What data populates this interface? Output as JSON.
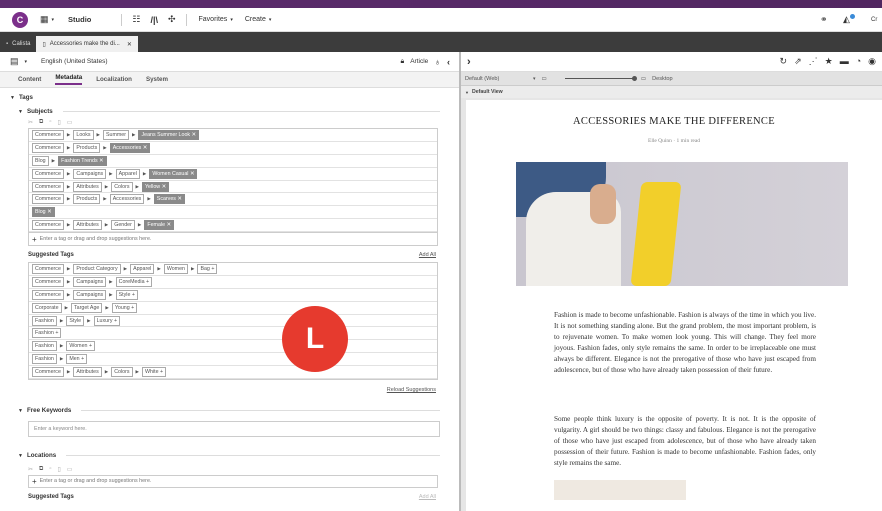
{
  "topbar": {
    "studio": "Studio",
    "favorites": "Favorites",
    "create": "Create",
    "user_initials": "Cr"
  },
  "tabs": [
    {
      "label": "Calista"
    },
    {
      "label": "Accessories make the di..."
    }
  ],
  "left_toolbar": {
    "locale": "English (United States)",
    "doc_type": "Article"
  },
  "subtabs": [
    "Content",
    "Metadata",
    "Localization",
    "System"
  ],
  "tags": {
    "title": "Tags",
    "subjects_title": "Subjects",
    "subject_rows": [
      [
        {
          "t": "Commerce"
        },
        {
          "t": "Looks"
        },
        {
          "t": "Summer"
        },
        {
          "t": "Jeans Summer Look ✕",
          "s": true
        }
      ],
      [
        {
          "t": "Commerce"
        },
        {
          "t": "Products"
        },
        {
          "t": "Accessories ✕",
          "s": true
        }
      ],
      [
        {
          "t": "Blog"
        },
        {
          "t": "Fashion Trends ✕",
          "s": true
        }
      ],
      [
        {
          "t": "Commerce"
        },
        {
          "t": "Campaigns"
        },
        {
          "t": "Apparel"
        },
        {
          "t": "Women Casual ✕",
          "s": true
        }
      ],
      [
        {
          "t": "Commerce"
        },
        {
          "t": "Attributes"
        },
        {
          "t": "Colors"
        },
        {
          "t": "Yellow ✕",
          "s": true
        }
      ],
      [
        {
          "t": "Commerce"
        },
        {
          "t": "Products"
        },
        {
          "t": "Accessories"
        },
        {
          "t": "Scarves ✕",
          "s": true
        }
      ],
      [
        {
          "t": "Blog ✕",
          "s": true
        }
      ],
      [
        {
          "t": "Commerce"
        },
        {
          "t": "Attributes"
        },
        {
          "t": "Gender"
        },
        {
          "t": "Female ✕",
          "s": true
        }
      ]
    ],
    "add_placeholder": "Enter a tag or drag and drop suggestions here.",
    "suggested_title": "Suggested Tags",
    "add_all": "Add All",
    "suggested_rows": [
      [
        {
          "t": "Commerce"
        },
        {
          "t": "Product Category"
        },
        {
          "t": "Apparel"
        },
        {
          "t": "Women"
        },
        {
          "t": "Bag +"
        }
      ],
      [
        {
          "t": "Commerce"
        },
        {
          "t": "Campaigns"
        },
        {
          "t": "CoreMedia +"
        }
      ],
      [
        {
          "t": "Commerce"
        },
        {
          "t": "Campaigns"
        },
        {
          "t": "Style +"
        }
      ],
      [
        {
          "t": "Corporate"
        },
        {
          "t": "Target Age"
        },
        {
          "t": "Young +"
        }
      ],
      [
        {
          "t": "Fashion"
        },
        {
          "t": "Style"
        },
        {
          "t": "Luxury +"
        }
      ],
      [
        {
          "t": "Fashion +"
        }
      ],
      [
        {
          "t": "Fashion"
        },
        {
          "t": "Women +"
        }
      ],
      [
        {
          "t": "Fashion"
        },
        {
          "t": "Men +"
        }
      ],
      [
        {
          "t": "Commerce"
        },
        {
          "t": "Attributes"
        },
        {
          "t": "Colors"
        },
        {
          "t": "White +"
        }
      ]
    ],
    "reload": "Reload Suggestions",
    "free_keywords_title": "Free Keywords",
    "keyword_placeholder": "Enter a keyword here.",
    "locations_title": "Locations",
    "locations_placeholder": "Enter a tag or drag and drop suggestions here.",
    "suggested_title2": "Suggested Tags",
    "add_all2": "Add All"
  },
  "preview": {
    "device": "Default (Web)",
    "desktop": "Desktop",
    "view": "Default View",
    "title": "ACCESSORIES MAKE THE DIFFERENCE",
    "byline": "Elle Quinn · 1 min read",
    "p1": "Fashion is made to become unfashionable. Fashion is always of the time in which you live. It is not something standing alone. But the grand problem, the most important problem, is to rejuvenate women. To make women look young. This will change. They feel more joyous. Fashion fades, only style remains the same. In order to be irreplaceable one must always be different. Elegance is not the prerogative of those who have just escaped from adolescence, but of those who have already taken possession of their future.",
    "p2": "Some people think luxury is the opposite of poverty. It is not. It is the opposite of vulgarity. A girl should be two things: classy and fabulous. Elegance is not the prerogative of those who have just escaped from adolescence, but of those who have already taken possession of their future. Fashion is made to become unfashionable. Fashion fades, only style remains the same."
  },
  "badge": "L",
  "colors": {
    "accent": "#7b2f8a",
    "badge": "#e63a2e",
    "selected_chip": "#8a8a8a",
    "scarf": "#f2cf2a"
  }
}
